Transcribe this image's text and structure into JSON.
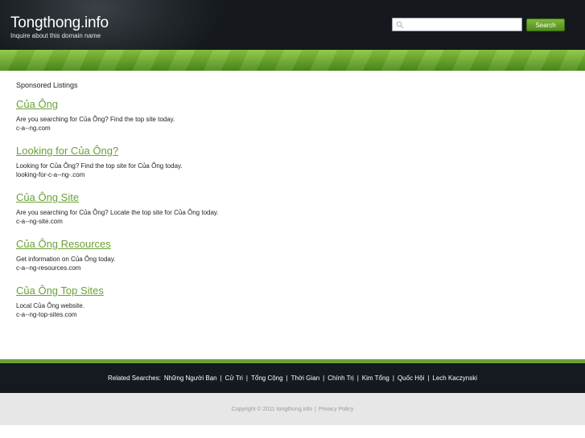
{
  "header": {
    "site_title": "Tongthong.info",
    "subtitle": "Inquire about this domain name",
    "search_placeholder": "",
    "search_button": "Search"
  },
  "main": {
    "sponsored_title": "Sponsored Listings",
    "listings": [
      {
        "title": "Của Ông",
        "description": "Are you searching for Của Ông? Find the top site today.",
        "url": "c-a--ng.com"
      },
      {
        "title": "Looking for Của Ông?",
        "description": "Looking for Của Ông? Find the top site for Của Ông today.",
        "url": "looking-for-c-a--ng-.com"
      },
      {
        "title": "Của Ông Site",
        "description": "Are you searching for Của Ông? Locate the top site for Của Ông today.",
        "url": "c-a--ng-site.com"
      },
      {
        "title": "Của Ông Resources",
        "description": "Get information on Của Ông today.",
        "url": "c-a--ng-resources.com"
      },
      {
        "title": "Của Ông Top Sites",
        "description": "Local Của Ông website.",
        "url": "c-a--ng-top-sites.com"
      }
    ]
  },
  "footer": {
    "related_label": "Related Searches:",
    "related": [
      "Những Người Bạn",
      "Cử Tri",
      "Tổng Cộng",
      "Thời Gian",
      "Chính Trị",
      "Kim Tổng",
      "Quốc Hội",
      "Lech Kaczynski"
    ],
    "separator": "|",
    "copyright": "Copyright © 2011 tongthong.info",
    "privacy": "Privacy Policy"
  },
  "colors": {
    "accent_green": "#6aa135",
    "header_dark": "#15191d",
    "footer_dark": "#141a1f",
    "footer_light": "#e7e7e7"
  }
}
